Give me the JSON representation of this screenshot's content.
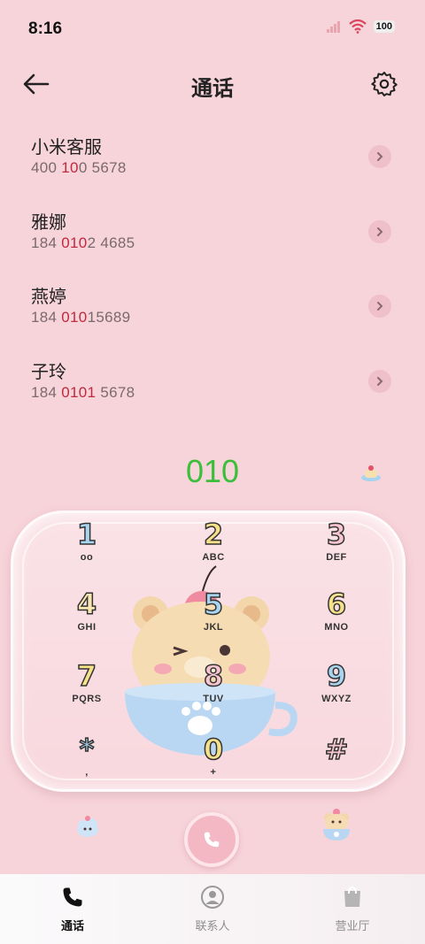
{
  "status_bar": {
    "time": "8:16",
    "battery": "100"
  },
  "header": {
    "title": "通话",
    "back_icon": "arrow-left-icon",
    "settings_icon": "gear-icon"
  },
  "contacts": [
    {
      "name": "小米客服",
      "number_parts": [
        "400 ",
        "10",
        "0 5678"
      ]
    },
    {
      "name": "雅娜",
      "number_parts": [
        "184 ",
        "010",
        "2 4685"
      ]
    },
    {
      "name": "燕婷",
      "number_parts": [
        "184 ",
        "010",
        "15689"
      ]
    },
    {
      "name": "子玲",
      "number_parts": [
        "184 ",
        "0101",
        " 5678"
      ]
    }
  ],
  "dialer": {
    "display": "010"
  },
  "keys": [
    {
      "digit": "1",
      "letters": "oo",
      "color": "#a9d4f0"
    },
    {
      "digit": "2",
      "letters": "ABC",
      "color": "#f6e08a"
    },
    {
      "digit": "3",
      "letters": "DEF",
      "color": "#f7c4cf"
    },
    {
      "digit": "4",
      "letters": "GHI",
      "color": "#f9e7b0"
    },
    {
      "digit": "5",
      "letters": "JKL",
      "color": "#a9d4f0"
    },
    {
      "digit": "6",
      "letters": "MNO",
      "color": "#f6e08a"
    },
    {
      "digit": "7",
      "letters": "PQRS",
      "color": "#f6e08a"
    },
    {
      "digit": "8",
      "letters": "TUV",
      "color": "#f7c4cf"
    },
    {
      "digit": "9",
      "letters": "WXYZ",
      "color": "#a9d4f0"
    },
    {
      "digit": "*",
      "letters": ",",
      "color": "#a9d4f0"
    },
    {
      "digit": "0",
      "letters": "+",
      "color": "#f6e08a"
    },
    {
      "digit": "#",
      "letters": "",
      "color": "#f7c4cf"
    }
  ],
  "nav": [
    {
      "label": "通话",
      "icon": "phone-icon",
      "active": true
    },
    {
      "label": "联系人",
      "icon": "person-icon",
      "active": false
    },
    {
      "label": "营业厅",
      "icon": "shopping-bag-icon",
      "active": false
    }
  ],
  "colors": {
    "background": "#f7d3da",
    "highlight": "#c0293e",
    "dial_text": "#3bbf3b"
  }
}
